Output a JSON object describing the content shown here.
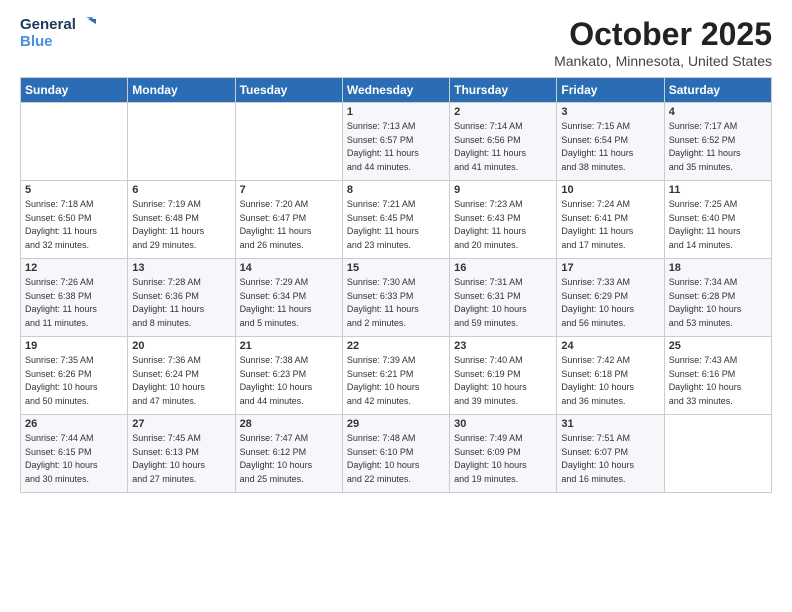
{
  "header": {
    "logo_line1": "General",
    "logo_line2": "Blue",
    "month": "October 2025",
    "location": "Mankato, Minnesota, United States"
  },
  "weekdays": [
    "Sunday",
    "Monday",
    "Tuesday",
    "Wednesday",
    "Thursday",
    "Friday",
    "Saturday"
  ],
  "weeks": [
    [
      {
        "day": "",
        "info": ""
      },
      {
        "day": "",
        "info": ""
      },
      {
        "day": "",
        "info": ""
      },
      {
        "day": "1",
        "info": "Sunrise: 7:13 AM\nSunset: 6:57 PM\nDaylight: 11 hours\nand 44 minutes."
      },
      {
        "day": "2",
        "info": "Sunrise: 7:14 AM\nSunset: 6:56 PM\nDaylight: 11 hours\nand 41 minutes."
      },
      {
        "day": "3",
        "info": "Sunrise: 7:15 AM\nSunset: 6:54 PM\nDaylight: 11 hours\nand 38 minutes."
      },
      {
        "day": "4",
        "info": "Sunrise: 7:17 AM\nSunset: 6:52 PM\nDaylight: 11 hours\nand 35 minutes."
      }
    ],
    [
      {
        "day": "5",
        "info": "Sunrise: 7:18 AM\nSunset: 6:50 PM\nDaylight: 11 hours\nand 32 minutes."
      },
      {
        "day": "6",
        "info": "Sunrise: 7:19 AM\nSunset: 6:48 PM\nDaylight: 11 hours\nand 29 minutes."
      },
      {
        "day": "7",
        "info": "Sunrise: 7:20 AM\nSunset: 6:47 PM\nDaylight: 11 hours\nand 26 minutes."
      },
      {
        "day": "8",
        "info": "Sunrise: 7:21 AM\nSunset: 6:45 PM\nDaylight: 11 hours\nand 23 minutes."
      },
      {
        "day": "9",
        "info": "Sunrise: 7:23 AM\nSunset: 6:43 PM\nDaylight: 11 hours\nand 20 minutes."
      },
      {
        "day": "10",
        "info": "Sunrise: 7:24 AM\nSunset: 6:41 PM\nDaylight: 11 hours\nand 17 minutes."
      },
      {
        "day": "11",
        "info": "Sunrise: 7:25 AM\nSunset: 6:40 PM\nDaylight: 11 hours\nand 14 minutes."
      }
    ],
    [
      {
        "day": "12",
        "info": "Sunrise: 7:26 AM\nSunset: 6:38 PM\nDaylight: 11 hours\nand 11 minutes."
      },
      {
        "day": "13",
        "info": "Sunrise: 7:28 AM\nSunset: 6:36 PM\nDaylight: 11 hours\nand 8 minutes."
      },
      {
        "day": "14",
        "info": "Sunrise: 7:29 AM\nSunset: 6:34 PM\nDaylight: 11 hours\nand 5 minutes."
      },
      {
        "day": "15",
        "info": "Sunrise: 7:30 AM\nSunset: 6:33 PM\nDaylight: 11 hours\nand 2 minutes."
      },
      {
        "day": "16",
        "info": "Sunrise: 7:31 AM\nSunset: 6:31 PM\nDaylight: 10 hours\nand 59 minutes."
      },
      {
        "day": "17",
        "info": "Sunrise: 7:33 AM\nSunset: 6:29 PM\nDaylight: 10 hours\nand 56 minutes."
      },
      {
        "day": "18",
        "info": "Sunrise: 7:34 AM\nSunset: 6:28 PM\nDaylight: 10 hours\nand 53 minutes."
      }
    ],
    [
      {
        "day": "19",
        "info": "Sunrise: 7:35 AM\nSunset: 6:26 PM\nDaylight: 10 hours\nand 50 minutes."
      },
      {
        "day": "20",
        "info": "Sunrise: 7:36 AM\nSunset: 6:24 PM\nDaylight: 10 hours\nand 47 minutes."
      },
      {
        "day": "21",
        "info": "Sunrise: 7:38 AM\nSunset: 6:23 PM\nDaylight: 10 hours\nand 44 minutes."
      },
      {
        "day": "22",
        "info": "Sunrise: 7:39 AM\nSunset: 6:21 PM\nDaylight: 10 hours\nand 42 minutes."
      },
      {
        "day": "23",
        "info": "Sunrise: 7:40 AM\nSunset: 6:19 PM\nDaylight: 10 hours\nand 39 minutes."
      },
      {
        "day": "24",
        "info": "Sunrise: 7:42 AM\nSunset: 6:18 PM\nDaylight: 10 hours\nand 36 minutes."
      },
      {
        "day": "25",
        "info": "Sunrise: 7:43 AM\nSunset: 6:16 PM\nDaylight: 10 hours\nand 33 minutes."
      }
    ],
    [
      {
        "day": "26",
        "info": "Sunrise: 7:44 AM\nSunset: 6:15 PM\nDaylight: 10 hours\nand 30 minutes."
      },
      {
        "day": "27",
        "info": "Sunrise: 7:45 AM\nSunset: 6:13 PM\nDaylight: 10 hours\nand 27 minutes."
      },
      {
        "day": "28",
        "info": "Sunrise: 7:47 AM\nSunset: 6:12 PM\nDaylight: 10 hours\nand 25 minutes."
      },
      {
        "day": "29",
        "info": "Sunrise: 7:48 AM\nSunset: 6:10 PM\nDaylight: 10 hours\nand 22 minutes."
      },
      {
        "day": "30",
        "info": "Sunrise: 7:49 AM\nSunset: 6:09 PM\nDaylight: 10 hours\nand 19 minutes."
      },
      {
        "day": "31",
        "info": "Sunrise: 7:51 AM\nSunset: 6:07 PM\nDaylight: 10 hours\nand 16 minutes."
      },
      {
        "day": "",
        "info": ""
      }
    ]
  ]
}
